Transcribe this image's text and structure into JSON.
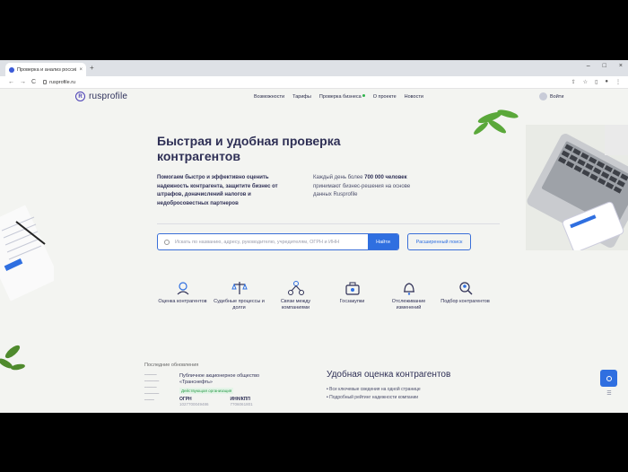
{
  "browser": {
    "tab_title": "Проверка и анализ россий",
    "tab_close": "×",
    "new_tab": "+",
    "url": "rusprofile.ru",
    "nav_back": "←",
    "nav_forward": "→",
    "nav_reload": "C",
    "window_controls": [
      "–",
      "□",
      "×"
    ]
  },
  "site": {
    "logo_text": "rusprofile",
    "nav": [
      "Возможности",
      "Тарифы",
      "Проверка бизнеса",
      "О проекте",
      "Новости"
    ],
    "login_label": "Войти"
  },
  "hero": {
    "title": "Быстрая и удобная проверка контрагентов",
    "left_text": "Помогаем быстро и эффективно оценить надежность контрагента, защитите бизнес от штрафов, доначислений налогов и недобросовестных партнеров",
    "right_prefix": "Каждый день более",
    "right_bold": "700 000 человек",
    "right_suffix": "принимают бизнес-решения на основе данных Rusprofile"
  },
  "search": {
    "placeholder": "Искать по названию, адресу, руководителю, учредителям, ОГРН и ИНН",
    "button_label": "Найти",
    "advanced_label": "Расширенный поиск"
  },
  "features": [
    {
      "label": "Оценка контрагентов",
      "icon": "badge-check-icon"
    },
    {
      "label": "Судебные процессы и долги",
      "icon": "scales-icon"
    },
    {
      "label": "Связи между компаниями",
      "icon": "network-icon"
    },
    {
      "label": "Госзакупки",
      "icon": "briefcase-icon"
    },
    {
      "label": "Отслеживание изменений",
      "icon": "bell-icon"
    },
    {
      "label": "Подбор контрагентов",
      "icon": "people-search-icon"
    }
  ],
  "updates": {
    "heading": "Последние обновления",
    "company_name": "Публичное акционерное общество «Транснефть»",
    "company_status": "Действующая организация",
    "ogrn_label": "ОГРН",
    "ogrn_value": "1027700049486",
    "inn_label": "ИНН/КПП",
    "inn_value": "7706061801"
  },
  "rating": {
    "title": "Удобная оценка контрагентов",
    "items": [
      "Все ключевые сведения на одной странице",
      "Подробный рейтинг надежности компании"
    ]
  },
  "colors": {
    "accent": "#2f6fe0",
    "brand": "#4a3fb5",
    "text_dark": "#2e2f55",
    "status_green": "#2a9d48"
  }
}
